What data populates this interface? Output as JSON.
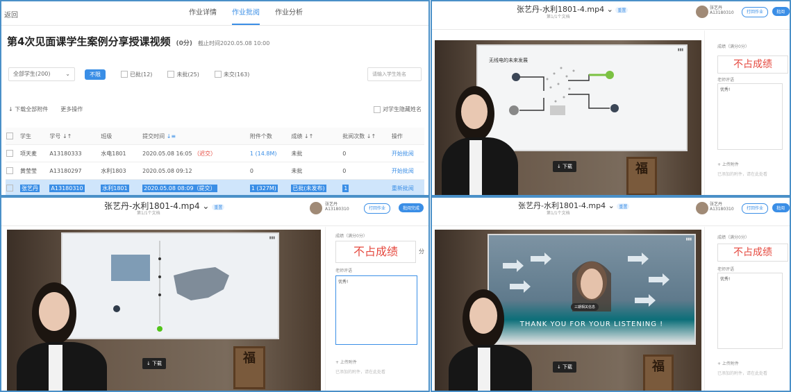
{
  "panel1": {
    "back_label": "返回",
    "tabs": [
      {
        "label": "作业详情"
      },
      {
        "label": "作业批阅"
      },
      {
        "label": "作业分析"
      }
    ],
    "homework_title": "第4次见面课学生案例分享授课视频",
    "homework_tag": "(0分)",
    "deadline": "截止时间2020.05.08 10:00",
    "filter": {
      "selected": "全部学生(200)",
      "btn_unsubmitted": "不限",
      "opt_batch": "已批(12)",
      "opt_unmarked": "未批(25)",
      "opt_unsubmitted": "未交(163)",
      "search_placeholder": "请输入学生姓名"
    },
    "actions": {
      "download_all": "下载全部附件",
      "more": "更多操作",
      "hide_names": "对学生隐藏姓名"
    },
    "table": {
      "headers": [
        "学生",
        "学号",
        "班级",
        "提交时间",
        "附件个数",
        "成绩",
        "批阅次数",
        "操作"
      ],
      "rows": [
        {
          "student": "项天麦",
          "id": "A13180333",
          "class": "水电1801",
          "time": "2020.05.08 16:05",
          "late": "（迟交）",
          "attach": "1 (14.8M)",
          "score": "未批",
          "count": "0",
          "op": "开始批阅"
        },
        {
          "student": "黄莹莹",
          "id": "A13180297",
          "class": "水利1803",
          "time": "2020.05.08 09:12",
          "late": "",
          "attach": "0",
          "score": "未批",
          "count": "0",
          "op": "开始批阅"
        },
        {
          "student": "张艺丹",
          "id": "A13180310",
          "class": "水利1801",
          "time": "2020.05.08 08:09",
          "late": "（提交）",
          "attach": "1 (327M)",
          "score": "已批(未发布)",
          "count": "1",
          "op": "重新批阅"
        }
      ]
    }
  },
  "video": {
    "title": "张艺丹-水利1801-4.mp4",
    "badge": "重置",
    "sub": "第1/1个文档",
    "user_name": "张艺丹",
    "user_id": "A13180310",
    "btn_open": "打回作业",
    "btn_finish": "批阅完成",
    "download": "↓ 下载",
    "score_label": "成绩（满分0分）",
    "no_score": "不占成绩",
    "fen": "分",
    "comment_label": "老师评语",
    "comment_text": "优秀!",
    "upload": "+ 上传附件",
    "upload_hint": "已添加的附件，请在此处看",
    "slide_title": "无线电的未来发展",
    "slide_thanks": "THANK YOU FOR YOUR LISTENING !",
    "slide_pill": "三期相关信息",
    "seal": "福"
  }
}
